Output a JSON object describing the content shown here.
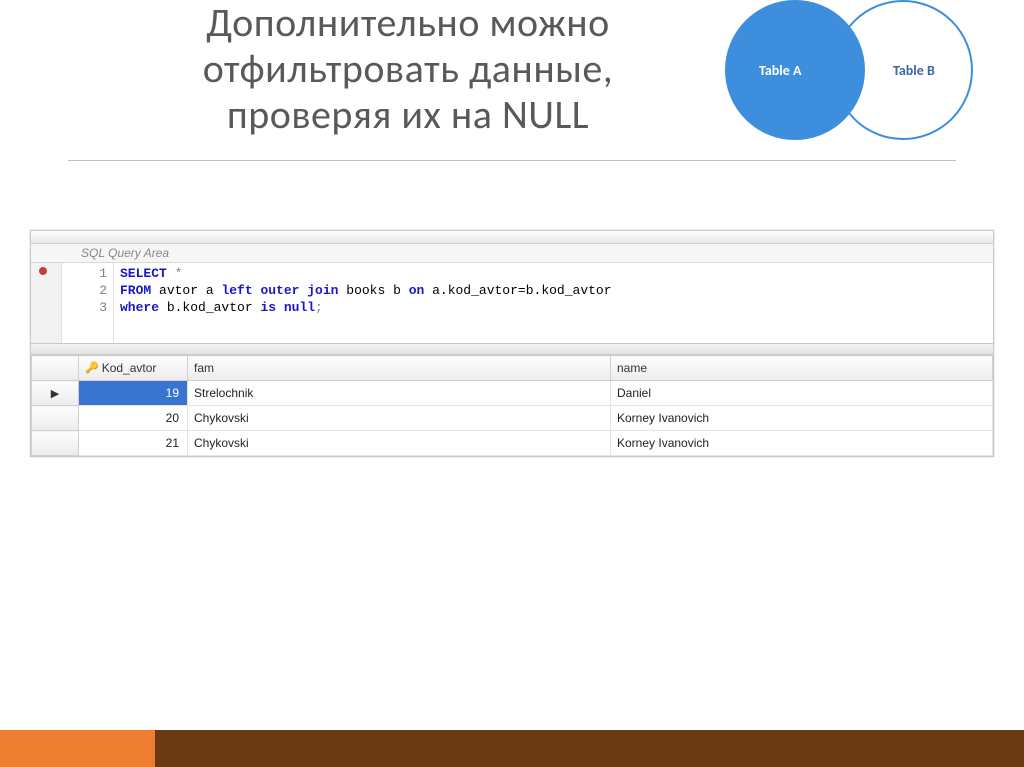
{
  "title_line1": "Дополнительно можно",
  "title_line2": "отфильтровать данные,",
  "title_line3": "проверяя их на NULL",
  "venn": {
    "a": "Table A",
    "b": "Table B"
  },
  "editor": {
    "area_label": "SQL Query Area",
    "lines": [
      "1",
      "2",
      "3"
    ],
    "code": {
      "select": "SELECT",
      "star": " *",
      "from": "FROM",
      "t1": " avtor a ",
      "join": "left outer join",
      "t2": " books b ",
      "on": "on",
      "cond": " a.kod_avtor=b.kod_avtor",
      "where": "where",
      "w1": " b.kod_avtor ",
      "isnull": "is null",
      "semi": ";"
    }
  },
  "grid": {
    "columns": {
      "kod": "Kod_avtor",
      "fam": "fam",
      "name": "name"
    },
    "rows": [
      {
        "kod": "19",
        "fam": "Strelochnik",
        "name": "Daniel",
        "current": true
      },
      {
        "kod": "20",
        "fam": "Chykovski",
        "name": "Korney Ivanovich",
        "current": false
      },
      {
        "kod": "21",
        "fam": "Chykovski",
        "name": "Korney Ivanovich",
        "current": false
      }
    ]
  }
}
